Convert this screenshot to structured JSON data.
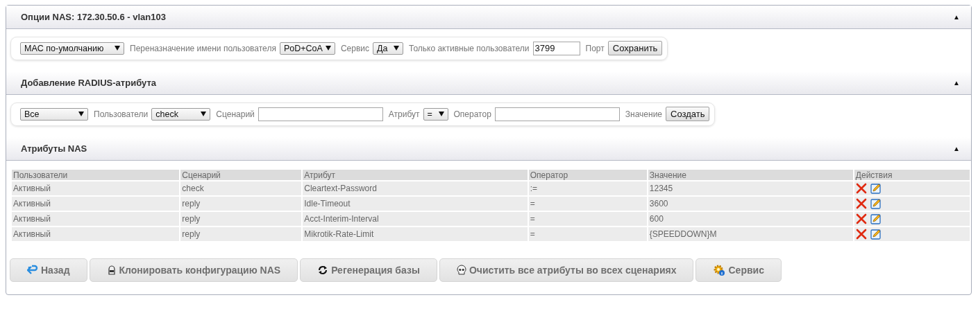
{
  "sections": [
    {
      "title": "Опции NAS: 172.30.50.6 - vlan103",
      "toggle": "▲",
      "form": [
        {
          "kind": "select",
          "value": "MAC по-умолчанию"
        },
        {
          "kind": "label",
          "text": "Переназначение имени пользователя"
        },
        {
          "kind": "select",
          "value": "PoD+CoA"
        },
        {
          "kind": "label",
          "text": "Сервис"
        },
        {
          "kind": "select",
          "value": "Да"
        },
        {
          "kind": "label",
          "text": "Только активные пользователи"
        },
        {
          "kind": "input",
          "value": "3799"
        },
        {
          "kind": "label",
          "text": "Порт"
        },
        {
          "kind": "button",
          "text": "Сохранить"
        }
      ]
    },
    {
      "title": "Добавление RADIUS-атрибута",
      "toggle": "▲",
      "form": [
        {
          "kind": "select",
          "value": "Все"
        },
        {
          "kind": "label",
          "text": "Пользователи"
        },
        {
          "kind": "select",
          "value": "check"
        },
        {
          "kind": "label",
          "text": "Сценарий"
        },
        {
          "kind": "input"
        },
        {
          "kind": "label",
          "text": "Атрибут"
        },
        {
          "kind": "select",
          "value": "="
        },
        {
          "kind": "label",
          "text": "Оператор"
        },
        {
          "kind": "input"
        },
        {
          "kind": "label",
          "text": "Значение"
        },
        {
          "kind": "button",
          "text": "Создать"
        }
      ]
    },
    {
      "title": "Атрибуты NAS",
      "toggle": "▲"
    }
  ],
  "table": {
    "columns": [
      "Пользователи",
      "Сценарий",
      "Атрибут",
      "Оператор",
      "Значение",
      "Действия"
    ],
    "rows": [
      [
        "Активный",
        "check",
        "Cleartext-Password",
        ":=",
        "12345"
      ],
      [
        "Активный",
        "reply",
        "Idle-Timeout",
        "=",
        "3600"
      ],
      [
        "Активный",
        "reply",
        "Acct-Interim-Interval",
        "=",
        "600"
      ],
      [
        "Активный",
        "reply",
        "Mikrotik-Rate-Limit",
        "=",
        "{SPEEDDOWN}M"
      ]
    ]
  },
  "buttons": [
    {
      "kind": "back",
      "label": "Назад"
    },
    {
      "kind": "clone",
      "label": "Клонировать конфигурацию NAS"
    },
    {
      "kind": "refresh",
      "label": "Регенерация базы"
    },
    {
      "kind": "skull",
      "label": "Очистить все атрибуты во всех сценариях"
    },
    {
      "kind": "gear",
      "label": "Сервис"
    }
  ]
}
